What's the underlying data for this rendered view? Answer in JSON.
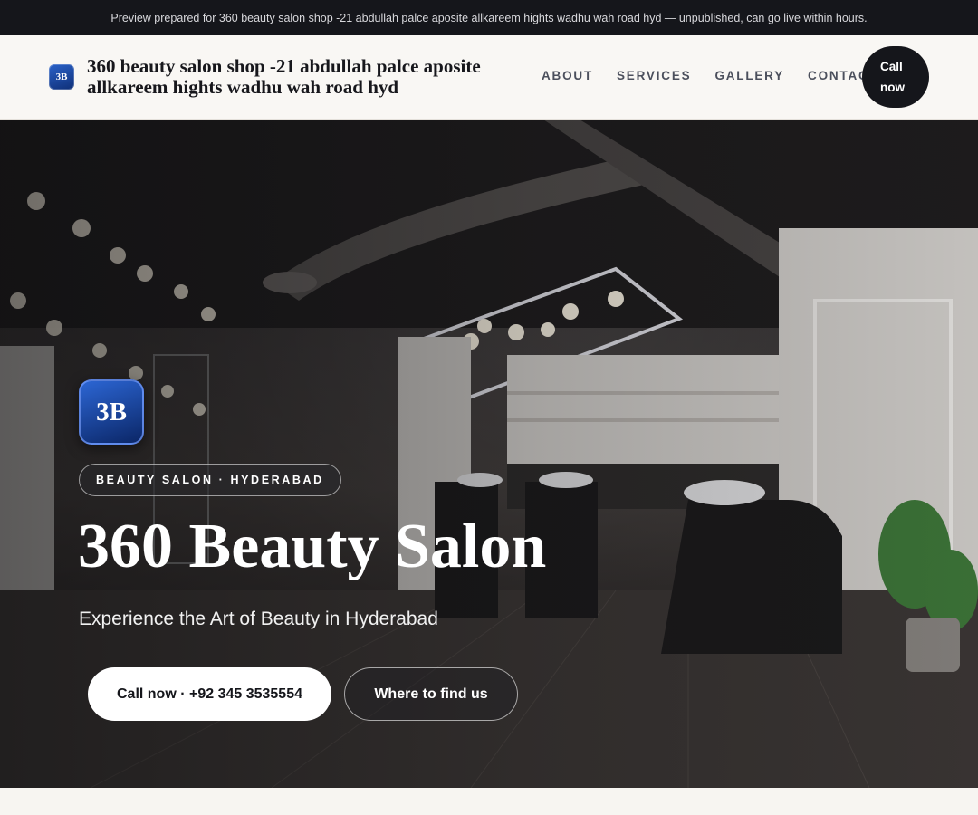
{
  "preview_banner": {
    "text": "Preview prepared for 360 beauty salon shop -21 abdullah palce aposite allkareem hights wadhu wah road hyd — unpublished, can go live within hours."
  },
  "header": {
    "logo_text": "3B",
    "brand_name": "360 beauty salon shop -21 abdullah palce aposite allkareem hights wadhu wah road hyd",
    "nav": [
      {
        "label": "ABOUT"
      },
      {
        "label": "SERVICES"
      },
      {
        "label": "GALLERY"
      },
      {
        "label": "CONTACT"
      }
    ],
    "call_label_line1": "Call",
    "call_label_line2": "now"
  },
  "hero": {
    "logo_text": "3B",
    "badge": "BEAUTY SALON · HYDERABAD",
    "title": "360 Beauty Salon",
    "subtitle": "Experience the Art of Beauty in Hyderabad",
    "primary_cta": "Call now · +92 345 3535554",
    "secondary_cta": "Where to find us",
    "background_icon": "salon-interior-photo"
  },
  "colors": {
    "dark": "#15161b",
    "brand_blue": "#1a48a8",
    "page_bg": "#f7f5f1"
  }
}
